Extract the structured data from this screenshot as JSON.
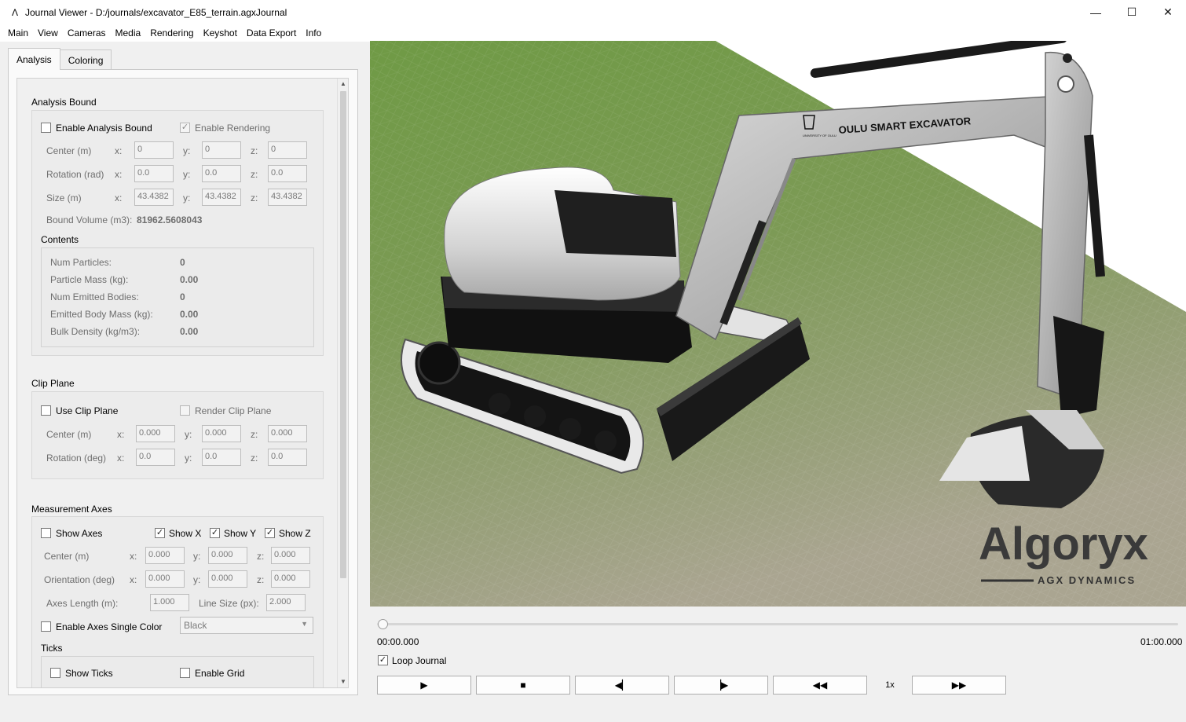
{
  "window": {
    "app_icon": "Λ",
    "title": "Journal Viewer - D:/journals/excavator_E85_terrain.agxJournal",
    "controls": [
      "—",
      "☐",
      "✕"
    ]
  },
  "menu": [
    "Main",
    "View",
    "Cameras",
    "Media",
    "Rendering",
    "Keyshot",
    "Data Export",
    "Info"
  ],
  "tabs": [
    "Analysis",
    "Coloring"
  ],
  "analysis_bound": {
    "title": "Analysis Bound",
    "enable_label": "Enable Analysis Bound",
    "enable_checked": false,
    "render_label": "Enable Rendering",
    "render_checked": true,
    "axis_x": "x:",
    "axis_y": "y:",
    "axis_z": "z:",
    "center_label": "Center (m)",
    "center": [
      "0",
      "0",
      "0"
    ],
    "rotation_label": "Rotation (rad)",
    "rotation": [
      "0.0",
      "0.0",
      "0.0"
    ],
    "size_label": "Size (m)",
    "size": [
      "43.4382",
      "43.4382",
      "43.4382"
    ],
    "volume_label": "Bound Volume (m3):",
    "volume_value": "81962.5608043"
  },
  "contents": {
    "title": "Contents",
    "rows": [
      {
        "label": "Num Particles:",
        "value": "0"
      },
      {
        "label": "Particle Mass (kg):",
        "value": "0.00"
      },
      {
        "label": "Num Emitted Bodies:",
        "value": "0"
      },
      {
        "label": "Emitted Body Mass (kg):",
        "value": "0.00"
      },
      {
        "label": "Bulk Density (kg/m3):",
        "value": "0.00"
      }
    ]
  },
  "clip_plane": {
    "title": "Clip Plane",
    "use_label": "Use Clip Plane",
    "use_checked": false,
    "render_label": "Render Clip Plane",
    "render_checked": false,
    "center_label": "Center (m)",
    "center": [
      "0.000",
      "0.000",
      "0.000"
    ],
    "rotation_label": "Rotation (deg)",
    "rotation": [
      "0.0",
      "0.0",
      "0.0"
    ]
  },
  "measurement_axes": {
    "title": "Measurement Axes",
    "show_axes_label": "Show Axes",
    "show_axes_checked": false,
    "show_x_label": "Show X",
    "show_x_checked": true,
    "show_y_label": "Show Y",
    "show_y_checked": true,
    "show_z_label": "Show Z",
    "show_z_checked": true,
    "center_label": "Center (m)",
    "center": [
      "0.000",
      "0.000",
      "0.000"
    ],
    "orientation_label": "Orientation (deg)",
    "orientation": [
      "0.000",
      "0.000",
      "0.000"
    ],
    "length_label": "Axes Length (m):",
    "length_value": "1.000",
    "line_size_label": "Line Size (px):",
    "line_size_value": "2.000",
    "single_color_label": "Enable Axes Single Color",
    "single_color_checked": false,
    "color_value": "Black",
    "ticks_title": "Ticks",
    "show_ticks_label": "Show Ticks",
    "enable_grid_label": "Enable Grid"
  },
  "viewport": {
    "boom_text": "OULU SMART EXCAVATOR",
    "university_text": "UNIVERSITY OF OULU",
    "logo_text": "Algoryx",
    "logo_sub": "AGX DYNAMICS",
    "colors": {
      "grass": "#7a9a52",
      "dirt": "#a8a290",
      "machine_light": "#d9d9d9",
      "machine_dark": "#1c1c1c"
    }
  },
  "playback": {
    "progress": 0.0,
    "time_start": "00:00.000",
    "time_end": "01:00.000",
    "loop_label": "Loop Journal",
    "loop_checked": true,
    "speed": "1x",
    "buttons": [
      {
        "name": "play",
        "icon": "▶"
      },
      {
        "name": "stop",
        "icon": "■"
      },
      {
        "name": "step-back",
        "icon": "◀▏"
      },
      {
        "name": "step-forward",
        "icon": "▕▶"
      },
      {
        "name": "rewind",
        "icon": "◀◀"
      },
      {
        "name": "fast-forward",
        "icon": "▶▶"
      }
    ]
  }
}
